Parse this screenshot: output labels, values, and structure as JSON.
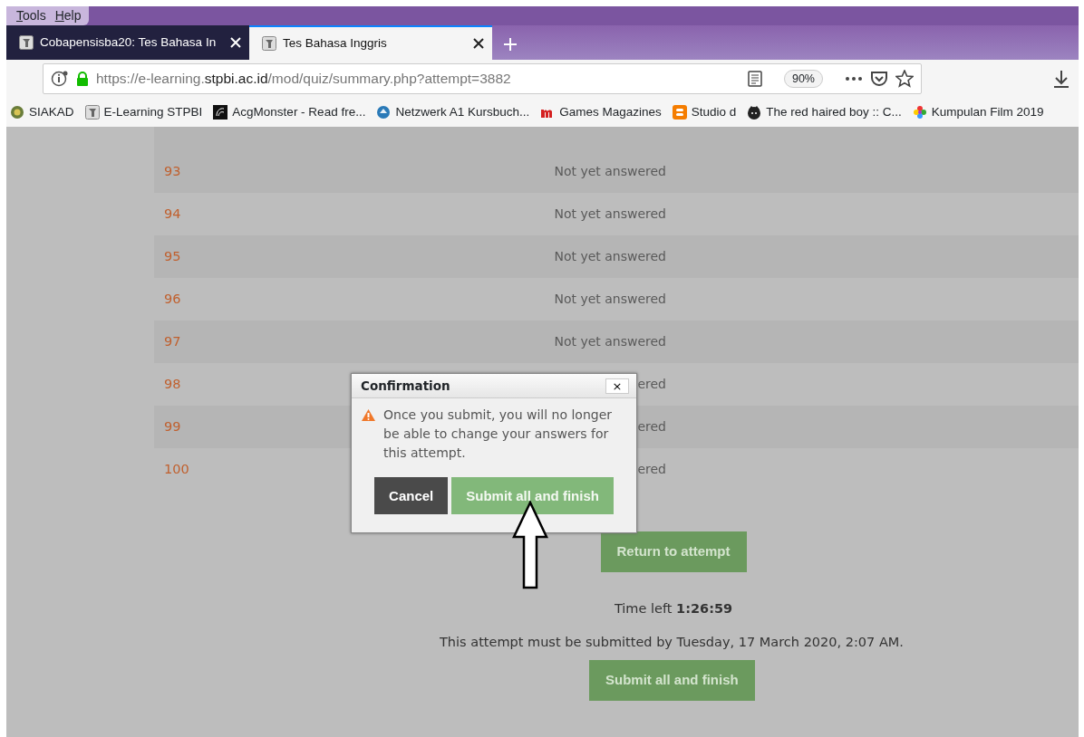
{
  "menu": [
    {
      "label": "Tools"
    },
    {
      "label": "Help"
    }
  ],
  "tabs": [
    {
      "title": "Cobapensisba20: Tes Bahasa In",
      "selected": false
    },
    {
      "title": "Tes Bahasa Inggris",
      "selected": true
    }
  ],
  "address_bar": {
    "url_start": "https://e-learning.",
    "url_domain": "stpbi.ac.id",
    "url_rest": "/mod/quiz/summary.php?attempt=3882",
    "zoom": "90%"
  },
  "bookmarks": [
    {
      "label": "SIAKAD"
    },
    {
      "label": "E-Learning STPBI"
    },
    {
      "label": "AcgMonster - Read fre..."
    },
    {
      "label": "Netzwerk A1 Kursbuch..."
    },
    {
      "label": "Games Magazines"
    },
    {
      "label": "Studio d"
    },
    {
      "label": "The red haired boy :: C..."
    },
    {
      "label": "Kumpulan Film 2019"
    }
  ],
  "question_rows": [
    {
      "number": "93",
      "status": "Not yet answered"
    },
    {
      "number": "94",
      "status": "Not yet answered"
    },
    {
      "number": "95",
      "status": "Not yet answered"
    },
    {
      "number": "96",
      "status": "Not yet answered"
    },
    {
      "number": "97",
      "status": "Not yet answered"
    },
    {
      "number": "98",
      "status": "ered"
    },
    {
      "number": "99",
      "status": "ered"
    },
    {
      "number": "100",
      "status": "ered"
    }
  ],
  "return_button": "Return to attempt",
  "time_left": "Time left **1:26:59**",
  "deadline": "This attempt must be submitted by Tuesday, 17 March 2020, 2:07 AM.",
  "submit_button": "Submit all and finish",
  "dialog": {
    "title": "Confirmation",
    "close": "×",
    "message": "Once you submit, you will no longer be able to change your answers for this attempt.",
    "buttons": [
      {
        "label": "Cancel",
        "kind": "secondary"
      },
      {
        "label": "Submit all and finish",
        "kind": "primary"
      }
    ]
  }
}
